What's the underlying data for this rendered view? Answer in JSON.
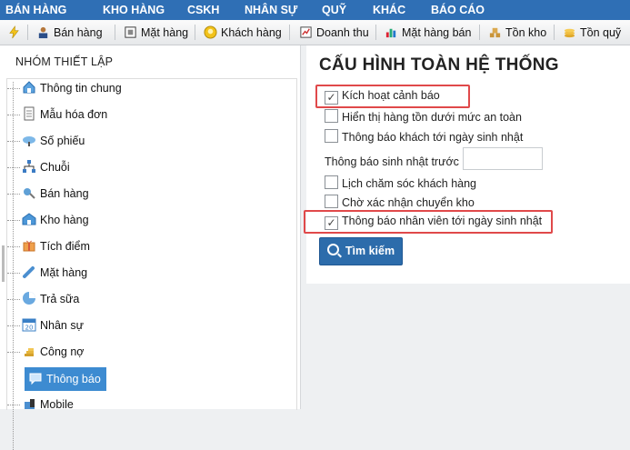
{
  "topnav": [
    "BÁN HÀNG",
    "KHO HÀNG",
    "CSKH",
    "NHÂN SỰ",
    "QUỸ",
    "KHÁC",
    "BÁO CÁO"
  ],
  "toolbar": [
    {
      "label": "",
      "icon": "lightning-icon"
    },
    {
      "label": "Bán hàng",
      "icon": "cashier-icon"
    },
    {
      "label": "Mặt hàng",
      "icon": "product-icon"
    },
    {
      "label": "Khách hàng",
      "icon": "customer-icon"
    },
    {
      "label": "Doanh thu",
      "icon": "revenue-icon"
    },
    {
      "label": "Mặt hàng bán",
      "icon": "sales-chart-icon"
    },
    {
      "label": "Tồn kho",
      "icon": "stock-icon"
    },
    {
      "label": "Tồn quỹ",
      "icon": "fund-icon"
    }
  ],
  "sidebar": {
    "title": "NHÓM THIẾT LẬP",
    "items": [
      {
        "label": "Thông tin chung",
        "icon": "home-icon"
      },
      {
        "label": "Mẫu hóa đơn",
        "icon": "document-icon"
      },
      {
        "label": "Số phiếu",
        "icon": "cloud-icon"
      },
      {
        "label": "Chuỗi",
        "icon": "network-icon"
      },
      {
        "label": "Bán hàng",
        "icon": "sale-icon"
      },
      {
        "label": "Kho hàng",
        "icon": "warehouse-icon"
      },
      {
        "label": "Tích điểm",
        "icon": "points-icon"
      },
      {
        "label": "Mặt hàng",
        "icon": "tag-icon"
      },
      {
        "label": "Trả sữa",
        "icon": "pie-icon"
      },
      {
        "label": "Nhân sự",
        "icon": "calendar-icon"
      },
      {
        "label": "Công nợ",
        "icon": "coins-icon"
      },
      {
        "label": "Thông báo",
        "icon": "chat-icon"
      },
      {
        "label": "Mobile",
        "icon": "mobile-icon"
      }
    ],
    "active": "Thông báo"
  },
  "main": {
    "title": "CẤU HÌNH TOÀN HỆ THỐNG",
    "options": [
      {
        "label": "Kích hoạt cảnh báo",
        "checked": true
      },
      {
        "label": "Hiển thị hàng tồn dưới mức an toàn",
        "checked": false
      },
      {
        "label": "Thông báo khách tới ngày sinh nhật",
        "checked": false
      }
    ],
    "birthday_before_label": "Thông báo sinh nhật trước",
    "birthday_before_value": "",
    "options2": [
      {
        "label": "Lịch chăm sóc khách hàng",
        "checked": false
      },
      {
        "label": "Chờ xác nhận chuyển kho",
        "checked": false
      },
      {
        "label": "Thông báo nhân viên tới ngày sinh nhật",
        "checked": true
      }
    ],
    "search_button": "Tìm kiếm"
  },
  "colors": {
    "nav": "#2f6fb5",
    "active": "#3d8bd1",
    "button": "#2c6cab",
    "highlight": "#e0494a"
  }
}
